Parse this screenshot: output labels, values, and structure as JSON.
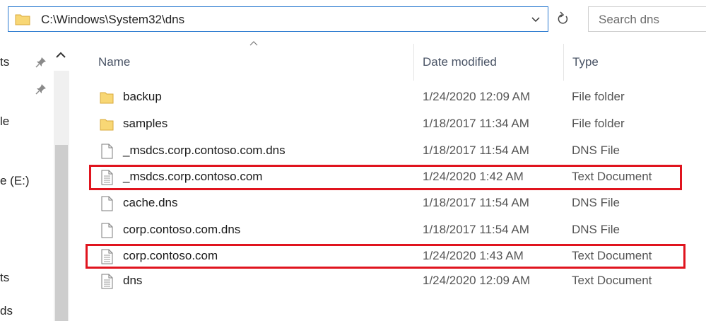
{
  "address_bar": {
    "path": "C:\\Windows\\System32\\dns"
  },
  "search": {
    "placeholder": "Search dns"
  },
  "nav": {
    "items": [
      {
        "label": "ts",
        "pinned": true
      },
      {
        "label": "",
        "pinned": true
      },
      {
        "label": "le"
      },
      {
        "label": "e (E:)"
      },
      {
        "label": "ts"
      },
      {
        "label": "ds"
      }
    ]
  },
  "columns": {
    "name": "Name",
    "date": "Date modified",
    "type": "Type",
    "sorted_by": "Name"
  },
  "files": [
    {
      "name": "backup",
      "date": "1/24/2020 12:09 AM",
      "type": "File folder",
      "icon": "folder-icon",
      "highlighted": false
    },
    {
      "name": "samples",
      "date": "1/18/2017 11:34 AM",
      "type": "File folder",
      "icon": "folder-icon",
      "highlighted": false
    },
    {
      "name": "_msdcs.corp.contoso.com.dns",
      "date": "1/18/2017 11:54 AM",
      "type": "DNS File",
      "icon": "file-icon",
      "highlighted": false
    },
    {
      "name": "_msdcs.corp.contoso.com",
      "date": "1/24/2020 1:42 AM",
      "type": "Text Document",
      "icon": "text-document-icon",
      "highlighted": true
    },
    {
      "name": "cache.dns",
      "date": "1/18/2017 11:54 AM",
      "type": "DNS File",
      "icon": "file-icon",
      "highlighted": false
    },
    {
      "name": "corp.contoso.com.dns",
      "date": "1/18/2017 11:54 AM",
      "type": "DNS File",
      "icon": "file-icon",
      "highlighted": false
    },
    {
      "name": "corp.contoso.com",
      "date": "1/24/2020 1:43 AM",
      "type": "Text Document",
      "icon": "text-document-icon",
      "highlighted": true
    },
    {
      "name": "dns",
      "date": "1/24/2020 12:09 AM",
      "type": "Text Document",
      "icon": "text-document-icon",
      "highlighted": false
    }
  ],
  "colors": {
    "accent": "#2b7ad0",
    "highlight": "#e0141e",
    "folder": "#f8d775"
  }
}
